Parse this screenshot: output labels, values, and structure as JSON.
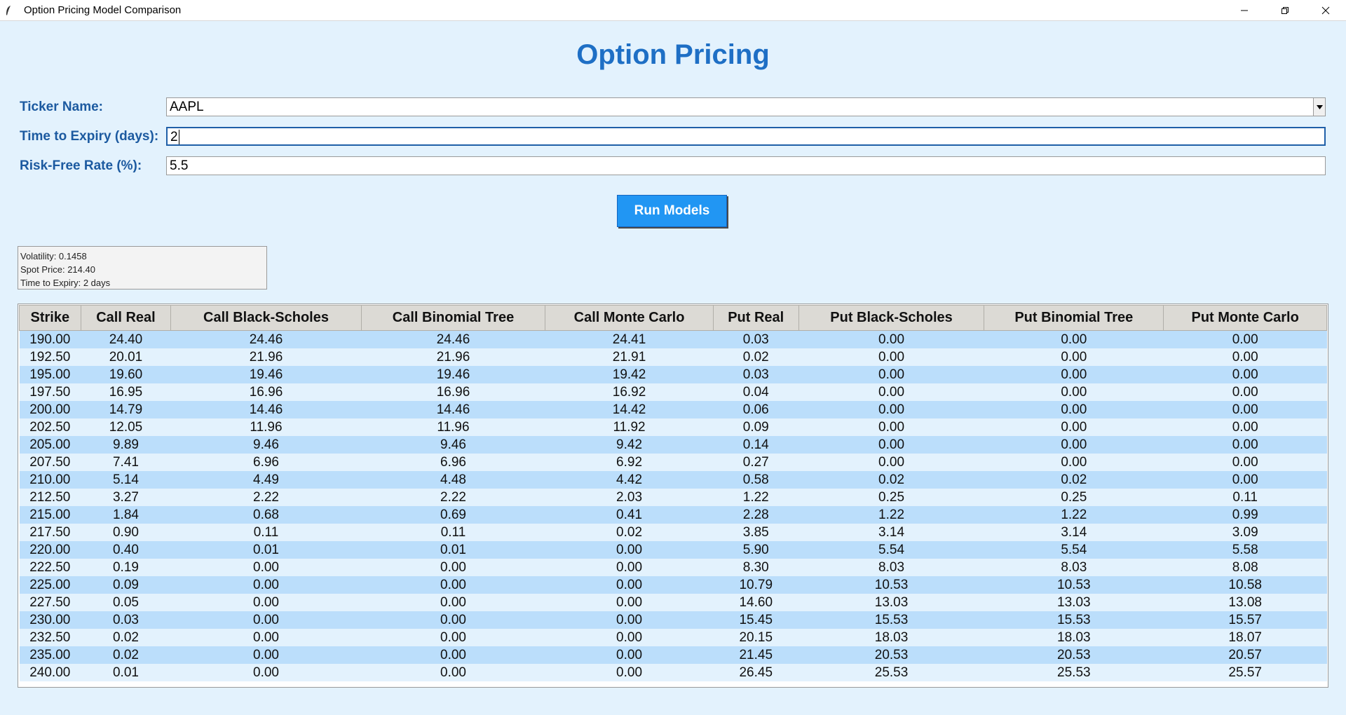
{
  "window": {
    "title": "Option Pricing Model Comparison"
  },
  "page": {
    "title": "Option Pricing"
  },
  "form": {
    "ticker_label": "Ticker Name:",
    "ticker_value": "AAPL",
    "expiry_label": "Time to Expiry (days):",
    "expiry_value": "2",
    "rate_label": "Risk-Free Rate (%):",
    "rate_value": "5.5",
    "run_label": "Run Models"
  },
  "info": {
    "volatility": "Volatility: 0.1458",
    "spot": "Spot Price: 214.40",
    "expiry": "Time to Expiry: 2 days"
  },
  "colors": {
    "background": "#e3f2fd",
    "title": "#1e6fc5",
    "label": "#1c5aa0",
    "button": "#2196f3",
    "row_odd": "#bbdefb",
    "row_even": "#e3f2fd"
  },
  "table": {
    "headers": [
      "Strike",
      "Call Real",
      "Call Black-Scholes",
      "Call Binomial Tree",
      "Call Monte Carlo",
      "Put Real",
      "Put Black-Scholes",
      "Put Binomial Tree",
      "Put Monte Carlo"
    ],
    "rows": [
      [
        "190.00",
        "24.40",
        "24.46",
        "24.46",
        "24.41",
        "0.03",
        "0.00",
        "0.00",
        "0.00"
      ],
      [
        "192.50",
        "20.01",
        "21.96",
        "21.96",
        "21.91",
        "0.02",
        "0.00",
        "0.00",
        "0.00"
      ],
      [
        "195.00",
        "19.60",
        "19.46",
        "19.46",
        "19.42",
        "0.03",
        "0.00",
        "0.00",
        "0.00"
      ],
      [
        "197.50",
        "16.95",
        "16.96",
        "16.96",
        "16.92",
        "0.04",
        "0.00",
        "0.00",
        "0.00"
      ],
      [
        "200.00",
        "14.79",
        "14.46",
        "14.46",
        "14.42",
        "0.06",
        "0.00",
        "0.00",
        "0.00"
      ],
      [
        "202.50",
        "12.05",
        "11.96",
        "11.96",
        "11.92",
        "0.09",
        "0.00",
        "0.00",
        "0.00"
      ],
      [
        "205.00",
        "9.89",
        "9.46",
        "9.46",
        "9.42",
        "0.14",
        "0.00",
        "0.00",
        "0.00"
      ],
      [
        "207.50",
        "7.41",
        "6.96",
        "6.96",
        "6.92",
        "0.27",
        "0.00",
        "0.00",
        "0.00"
      ],
      [
        "210.00",
        "5.14",
        "4.49",
        "4.48",
        "4.42",
        "0.58",
        "0.02",
        "0.02",
        "0.00"
      ],
      [
        "212.50",
        "3.27",
        "2.22",
        "2.22",
        "2.03",
        "1.22",
        "0.25",
        "0.25",
        "0.11"
      ],
      [
        "215.00",
        "1.84",
        "0.68",
        "0.69",
        "0.41",
        "2.28",
        "1.22",
        "1.22",
        "0.99"
      ],
      [
        "217.50",
        "0.90",
        "0.11",
        "0.11",
        "0.02",
        "3.85",
        "3.14",
        "3.14",
        "3.09"
      ],
      [
        "220.00",
        "0.40",
        "0.01",
        "0.01",
        "0.00",
        "5.90",
        "5.54",
        "5.54",
        "5.58"
      ],
      [
        "222.50",
        "0.19",
        "0.00",
        "0.00",
        "0.00",
        "8.30",
        "8.03",
        "8.03",
        "8.08"
      ],
      [
        "225.00",
        "0.09",
        "0.00",
        "0.00",
        "0.00",
        "10.79",
        "10.53",
        "10.53",
        "10.58"
      ],
      [
        "227.50",
        "0.05",
        "0.00",
        "0.00",
        "0.00",
        "14.60",
        "13.03",
        "13.03",
        "13.08"
      ],
      [
        "230.00",
        "0.03",
        "0.00",
        "0.00",
        "0.00",
        "15.45",
        "15.53",
        "15.53",
        "15.57"
      ],
      [
        "232.50",
        "0.02",
        "0.00",
        "0.00",
        "0.00",
        "20.15",
        "18.03",
        "18.03",
        "18.07"
      ],
      [
        "235.00",
        "0.02",
        "0.00",
        "0.00",
        "0.00",
        "21.45",
        "20.53",
        "20.53",
        "20.57"
      ],
      [
        "240.00",
        "0.01",
        "0.00",
        "0.00",
        "0.00",
        "26.45",
        "25.53",
        "25.53",
        "25.57"
      ]
    ]
  }
}
